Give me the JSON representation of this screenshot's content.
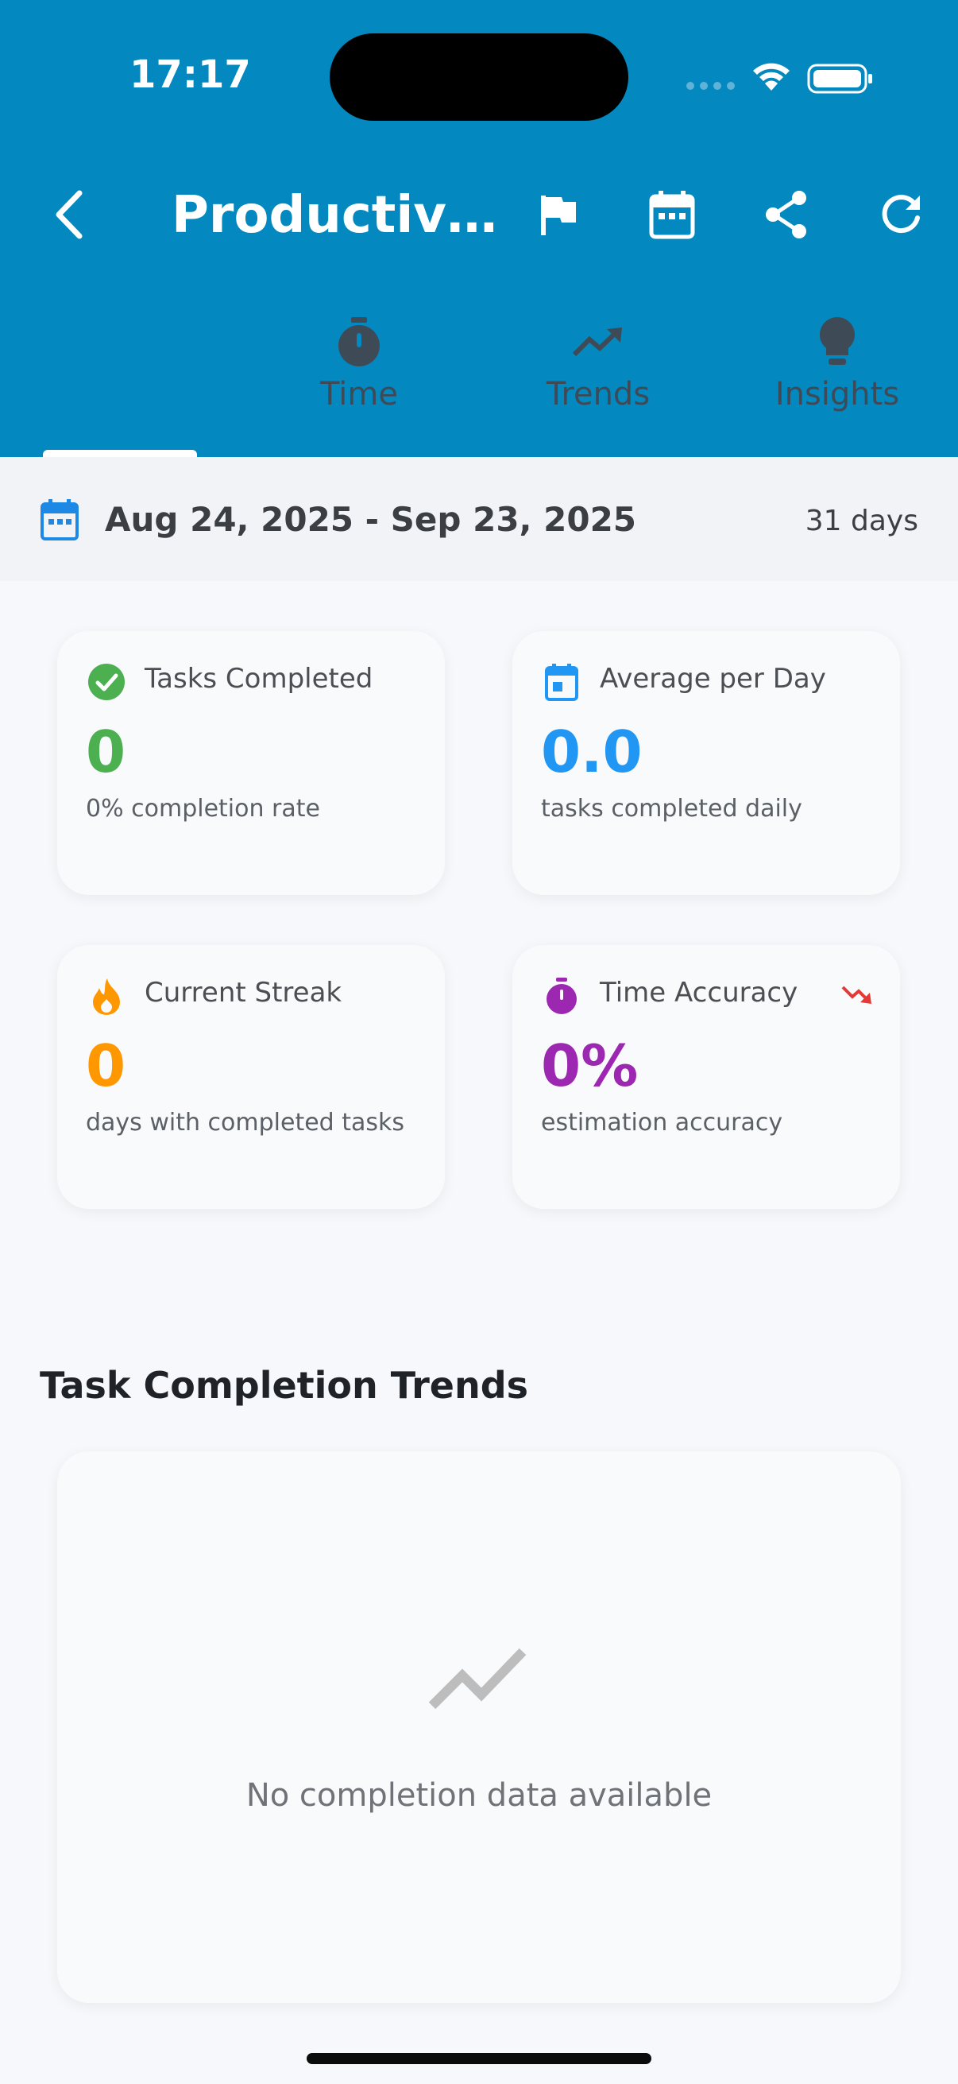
{
  "status_bar": {
    "time": "17:17"
  },
  "header": {
    "title": "Productiv…",
    "back_icon": "chevron-left-icon",
    "actions": [
      "flag-icon",
      "calendar-icon",
      "share-icon",
      "refresh-icon"
    ]
  },
  "tabs": [
    {
      "label": "Time",
      "icon": "timer-icon"
    },
    {
      "label": "Trends",
      "icon": "trending-up-icon"
    },
    {
      "label": "Insights",
      "icon": "lightbulb-icon"
    }
  ],
  "date_range": {
    "text": "Aug 24, 2025 - Sep 23, 2025",
    "days": "31 days"
  },
  "stats": {
    "tasks_completed": {
      "title": "Tasks Completed",
      "value": "0",
      "sub": "0% completion rate",
      "color": "#4caf50"
    },
    "average_per_day": {
      "title": "Average per Day",
      "value": "0.0",
      "sub": "tasks completed daily",
      "color": "#2196f3"
    },
    "current_streak": {
      "title": "Current Streak",
      "value": "0",
      "sub": "days with completed tasks",
      "color": "#ff9800"
    },
    "time_accuracy": {
      "title": "Time Accuracy",
      "value": "0%",
      "sub": "estimation accuracy",
      "color": "#9c27b0",
      "trend_color": "#e53935"
    }
  },
  "trends_section": {
    "title": "Task Completion Trends",
    "empty_message": "No completion data available"
  },
  "colors": {
    "header": "#0388c0",
    "background": "#f6f8fb"
  }
}
